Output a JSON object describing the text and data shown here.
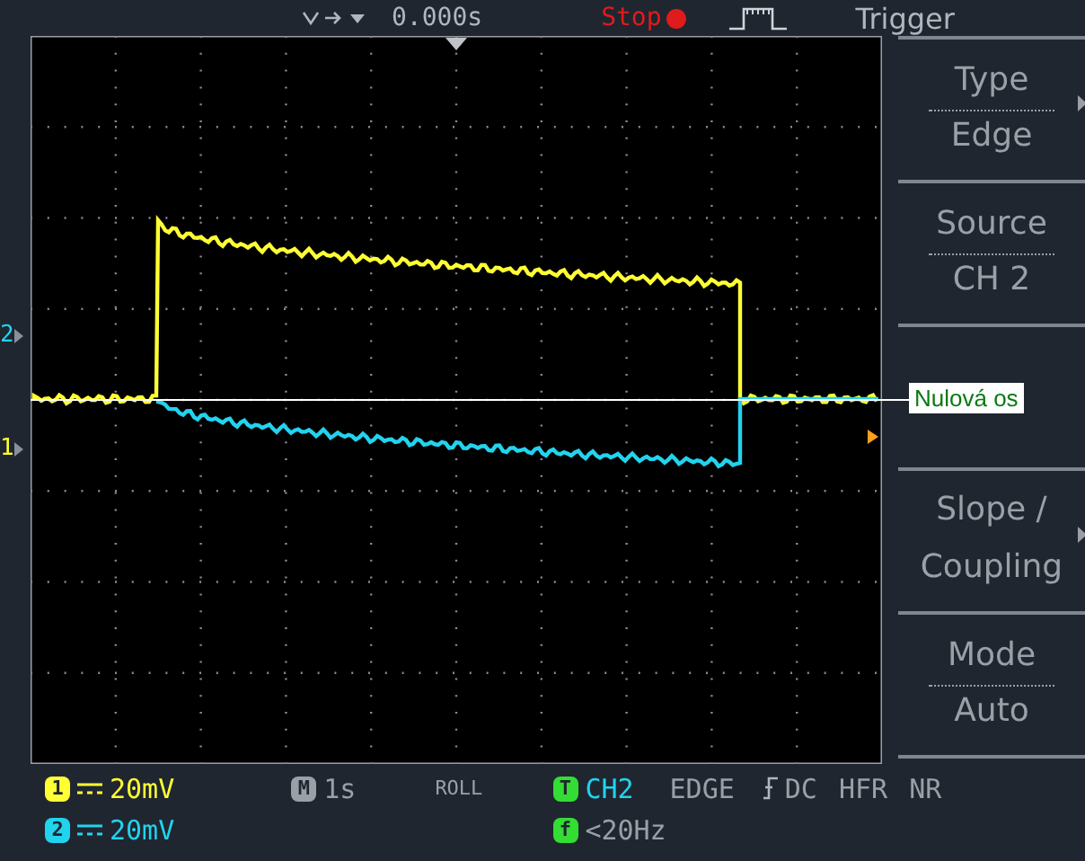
{
  "top_bar": {
    "trigger_position": "0.000s",
    "run_status": "Stop"
  },
  "screen": {
    "channel_markers": [
      {
        "number": "2",
        "color": "#22d3ee"
      },
      {
        "number": "1",
        "color": "#ffff33"
      }
    ],
    "annotation": "Nulová os"
  },
  "menu": {
    "title": "Trigger",
    "items": [
      {
        "kind": "pair",
        "lines": [
          "Type",
          "Edge"
        ],
        "submenu": true
      },
      {
        "kind": "pair",
        "lines": [
          "Source",
          "CH 2"
        ],
        "submenu": false
      },
      {
        "kind": "blank"
      },
      {
        "kind": "label",
        "lines": [
          "Slope /",
          "Coupling"
        ],
        "submenu": true
      },
      {
        "kind": "pair",
        "lines": [
          "Mode",
          "Auto"
        ],
        "submenu": false
      }
    ]
  },
  "status_bar": {
    "channels": [
      {
        "number": "1",
        "scale": "20mV",
        "color": "#ffff33"
      },
      {
        "number": "2",
        "scale": "20mV",
        "color": "#22d3ee"
      }
    ],
    "timebase": {
      "badge": "M",
      "value": "1s"
    },
    "mode": "ROLL",
    "trigger": {
      "badge": "T",
      "source": "CH2",
      "type": "EDGE",
      "coupling": "DC",
      "options": [
        "HFR",
        "NR"
      ]
    },
    "frequency": {
      "badge": "f",
      "value": "<20Hz"
    }
  }
}
